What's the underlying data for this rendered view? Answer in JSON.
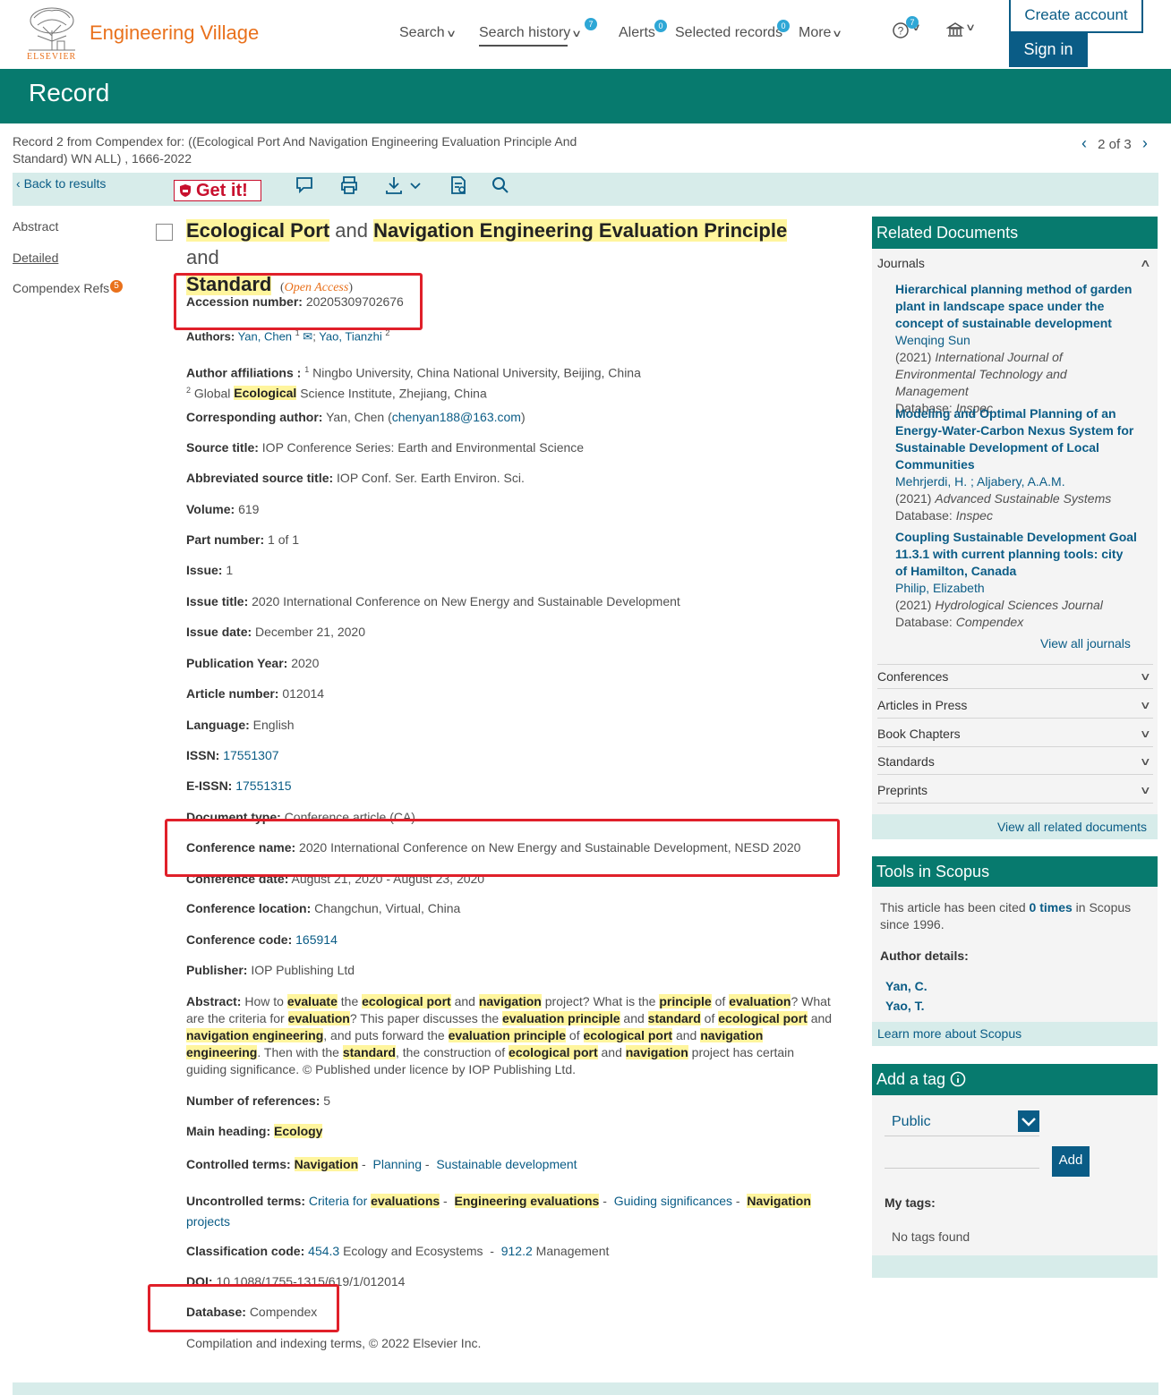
{
  "header": {
    "brand": "Engineering Village",
    "elsevier": "ELSEVIER",
    "nav": {
      "search": "Search",
      "search_history": "Search history",
      "search_history_badge": "7",
      "alerts": "Alerts",
      "alerts_badge": "0",
      "selected_records": "Selected records",
      "selected_badge": "0",
      "more": "More",
      "help_badge": "7"
    },
    "create_account": "Create account",
    "sign_in": "Sign in"
  },
  "banner": {
    "title": "Record"
  },
  "search_desc": "Record 2 from Compendex for: ((Ecological Port And Navigation Engineering Evaluation Principle And Standard) WN ALL) , 1666-2022",
  "pager": {
    "text": "2 of 3"
  },
  "toolbar": {
    "back": "Back to results",
    "getit": "Get it!"
  },
  "sidenav": {
    "abstract": "Abstract",
    "detailed": "Detailed",
    "refs": "Compendex Refs",
    "refs_badge": "5"
  },
  "article": {
    "title_parts": [
      "Ecological Port",
      " and ",
      "Navigation Engineering Evaluation Principle",
      " and "
    ],
    "title_line2": "Standard",
    "open_access": "Open Access",
    "accession_label": "Accession number:",
    "accession": "20205309702676",
    "authors_label": "Authors:",
    "author1": "Yan, Chen",
    "author2": "Yao, Tianzhi",
    "affil_label": "Author affiliations :",
    "affil1": "Ningbo University, China National University, Beijing, China",
    "affil2_pre": "Global",
    "affil2_hl": "Ecological",
    "affil2_post": "Science Institute, Zhejiang, China",
    "corr_label": "Corresponding author:",
    "corr_name": "Yan, Chen",
    "corr_email": "chenyan188@163.com",
    "source_label": "Source title:",
    "source": "IOP Conference Series: Earth and Environmental Science",
    "abbr_label": "Abbreviated source title:",
    "abbr": "IOP Conf. Ser. Earth Environ. Sci.",
    "volume_label": "Volume:",
    "volume": "619",
    "part_label": "Part number:",
    "part": "1 of 1",
    "issue_label": "Issue:",
    "issue": "1",
    "issue_title_label": "Issue title:",
    "issue_title": "2020 International Conference on New Energy and Sustainable Development",
    "issue_date_label": "Issue date:",
    "issue_date": "December 21, 2020",
    "pub_year_label": "Publication Year:",
    "pub_year": "2020",
    "article_num_label": "Article number:",
    "article_num": "012014",
    "language_label": "Language:",
    "language": "English",
    "issn_label": "ISSN:",
    "issn": "17551307",
    "eissn_label": "E-ISSN:",
    "eissn": "17551315",
    "doctype_label": "Document type:",
    "doctype": "Conference article (CA)",
    "conf_name_label": "Conference name:",
    "conf_name": "2020 International Conference on New Energy and Sustainable Development, NESD 2020",
    "conf_date_label": "Conference date:",
    "conf_date": "August 21, 2020 - August 23, 2020",
    "conf_loc_label": "Conference location:",
    "conf_loc": "Changchun, Virtual, China",
    "conf_code_label": "Conference code:",
    "conf_code": "165914",
    "publisher_label": "Publisher:",
    "publisher": "IOP Publishing Ltd",
    "abstract_label": "Abstract:",
    "refs_label": "Number of references:",
    "refs": "5",
    "main_heading_label": "Main heading:",
    "main_heading": "Ecology",
    "controlled_label": "Controlled terms:",
    "controlled": [
      "Navigation",
      "Planning",
      "Sustainable development"
    ],
    "uncontrolled_label": "Uncontrolled terms:",
    "class_label": "Classification code:",
    "class1_code": "454.3",
    "class1": "Ecology and Ecosystems",
    "class2_code": "912.2",
    "class2": "Management",
    "doi_label": "DOI:",
    "doi": "10.1088/1755-1315/619/1/012014",
    "database_label": "Database:",
    "database": "Compendex",
    "compilation": "Compilation and indexing terms, © 2022 Elsevier Inc."
  },
  "related": {
    "title": "Related Documents",
    "journals": "Journals",
    "docs": [
      {
        "title": "Hierarchical planning method of garden plant in landscape space under the concept of sustainable development",
        "authors": "Wenqing Sun",
        "year": "(2021)",
        "source": "International Journal of Environmental Technology and Management",
        "db_label": "Database:",
        "db": "Inspec"
      },
      {
        "title": "Modeling and Optimal Planning of an Energy-Water-Carbon Nexus System for Sustainable Development of Local Communities",
        "authors": "Mehrjerdi, H. ; Aljabery, A.A.M.",
        "year": "(2021)",
        "source": "Advanced Sustainable Systems",
        "db_label": "Database:",
        "db": "Inspec"
      },
      {
        "title": "Coupling Sustainable Development Goal 11.3.1 with current planning tools: city of Hamilton, Canada",
        "authors": "Philip, Elizabeth",
        "year": "(2021)",
        "source": "Hydrological Sciences Journal",
        "db_label": "Database:",
        "db": "Compendex"
      }
    ],
    "view_all_journals": "View all journals",
    "sections": [
      "Conferences",
      "Articles in Press",
      "Book Chapters",
      "Standards",
      "Preprints"
    ],
    "view_all": "View all related documents"
  },
  "scopus": {
    "title": "Tools in Scopus",
    "cited_pre": "This article has been cited",
    "cited_link": "0 times",
    "cited_post": "in Scopus since 1996.",
    "author_details": "Author details:",
    "authors": [
      "Yan, C.",
      "Yao, T."
    ],
    "learn_more": "Learn more about Scopus"
  },
  "tags": {
    "title": "Add a tag",
    "visibility": "Public",
    "add": "Add",
    "my_tags": "My tags:",
    "none": "No tags found"
  }
}
